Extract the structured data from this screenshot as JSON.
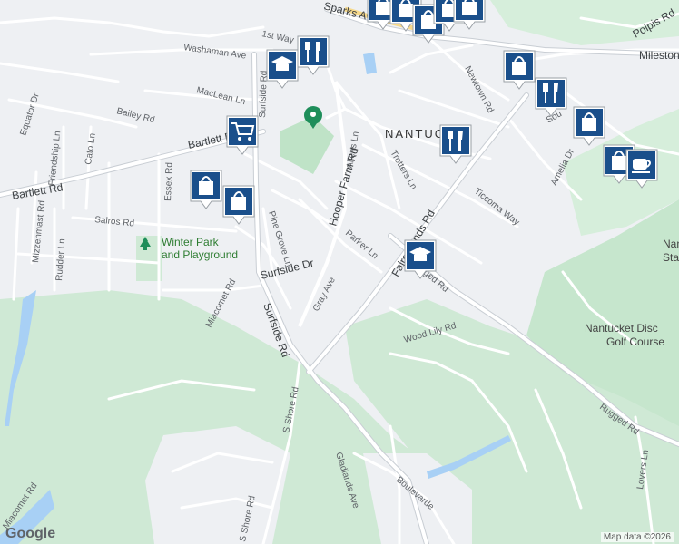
{
  "map": {
    "logo": "Google",
    "attribution": "Map data ©2026",
    "town_label": "NANTUCK",
    "streets": {
      "sparks_ave": "Sparks Ave",
      "first_way": "1st Way",
      "washaman": "Washaman Ave",
      "maclean": "MacLean Ln",
      "surfside_top": "Surfside Rd",
      "bailey": "Bailey Rd",
      "equator": "Equator Dr",
      "friendship": "Friendship Ln",
      "cato": "Cato Ln",
      "bartlett_top": "Bartlett Rd",
      "bartlett_left": "Bartlett Rd",
      "essex": "Essex Rd",
      "mizzenmast": "Mizzenmast Rd",
      "salros": "Salros Rd",
      "rudder": "Rudder Ln",
      "pine_grove": "Pine Grove Ln",
      "surfside_dr": "Surfside Dr",
      "miacomet": "Miacomet Rd",
      "surfside_rd": "Surfside Rd",
      "allens": "Allens Ln",
      "hooper_farm": "Hooper Farm Rd",
      "trotters": "Trotters Ln",
      "newtown": "Newtown Rd",
      "polpis": "Polpis Rd",
      "milestone": "Milestone",
      "sou": "Sou",
      "amelia": "Amelia Dr",
      "ticcoma": "Ticcoma Way",
      "fairgrounds": "Fairgrounds Rd",
      "parker": "Parker Ln",
      "gray": "Gray Ave",
      "rugged_top": "Rugged Rd",
      "wood_lily": "Wood Lily Rd",
      "rugged_bottom": "Rugged Rd",
      "lovers": "Lovers Ln",
      "s_shore_top": "S Shore Rd",
      "s_shore_bottom": "S Shore Rd",
      "gladlands": "Gladlands Ave",
      "boulevarde": "Boulevarde",
      "miacomet_bottom": "Miacomet Rd"
    },
    "places": {
      "winter_park_1": "Winter Park",
      "winter_park_2": "and Playground",
      "disc_golf_1": "Nantucket Disc",
      "disc_golf_2": "Golf Course",
      "state_1": "Nan",
      "state_2": "Stat"
    },
    "marker_color": "#1a4f8b",
    "park_color": "#cdebd3",
    "park_pin_color": "#1e8e5a"
  }
}
